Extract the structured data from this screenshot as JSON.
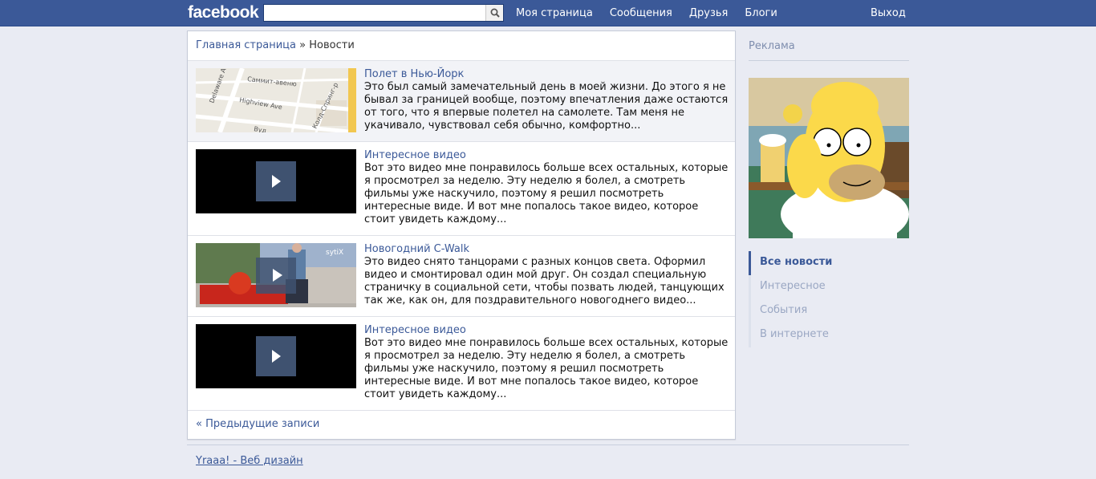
{
  "header": {
    "logo": "facebook",
    "search": {
      "value": "",
      "placeholder": ""
    },
    "nav": [
      "Моя страница",
      "Сообщения",
      "Друзья",
      "Блоги"
    ],
    "logout": "Выход"
  },
  "breadcrumb": {
    "home": "Главная страница",
    "separator": "»",
    "current": "Новости"
  },
  "posts": [
    {
      "title": "Полет в Нью-Йорк",
      "text": "Это был самый замечательный день в моей жизни. До этого я не бывал за границей вообще, поэтому впечатления даже остаются от того, что я впервые полетел на самолете. Там меня не укачивало, чувствовал себя обычно, комфортно...",
      "thumb_type": "map",
      "map_labels": [
        "Delaware Ave",
        "Саммит-авеню",
        "Highview Ave",
        "Колд-Спринг-р",
        "Вуд"
      ]
    },
    {
      "title": "Интересное видео",
      "text": "Вот это видео мне понравилось больше всех остальных, которые я просмотрел за неделю. Эту неделю я болел, а смотреть фильмы уже наскучило, поэтому я решил посмотреть интересные виде. И вот мне попалось такое видео, которое стоит увидеть каждому...",
      "thumb_type": "video"
    },
    {
      "title": "Новогодний C-Walk",
      "text": "Это видео снято танцорами с разных концов света. Оформил видео и смонтировал один мой друг. Он создал специальную страничку в социальной сети, чтобы позвать людей, танцующих так же, как он, для поздравительного новогоднего видео...",
      "thumb_type": "photo-video",
      "watermark": "sytiX"
    },
    {
      "title": "Интересное видео",
      "text": "Вот это видео мне понравилось больше всех остальных, которые я просмотрел за неделю. Эту неделю я болел, а смотреть фильмы уже наскучило, поэтому я решил посмотреть интересные виде. И вот мне попалось такое видео, которое стоит увидеть каждому...",
      "thumb_type": "video"
    }
  ],
  "prev_link": "« Предыдущие записи",
  "sidebar": {
    "ads_title": "Реклама",
    "menu": [
      {
        "label": "Все новости",
        "active": true
      },
      {
        "label": "Интересное",
        "active": false
      },
      {
        "label": "События",
        "active": false
      },
      {
        "label": "В интернете",
        "active": false
      }
    ]
  },
  "footer": "Yraaa! - Веб дизайн",
  "colors": {
    "brand": "#3b5998",
    "background": "#e9ebf3",
    "play_button": "#3f5270"
  },
  "icons": {
    "search": "search-icon",
    "play": "play-icon"
  }
}
